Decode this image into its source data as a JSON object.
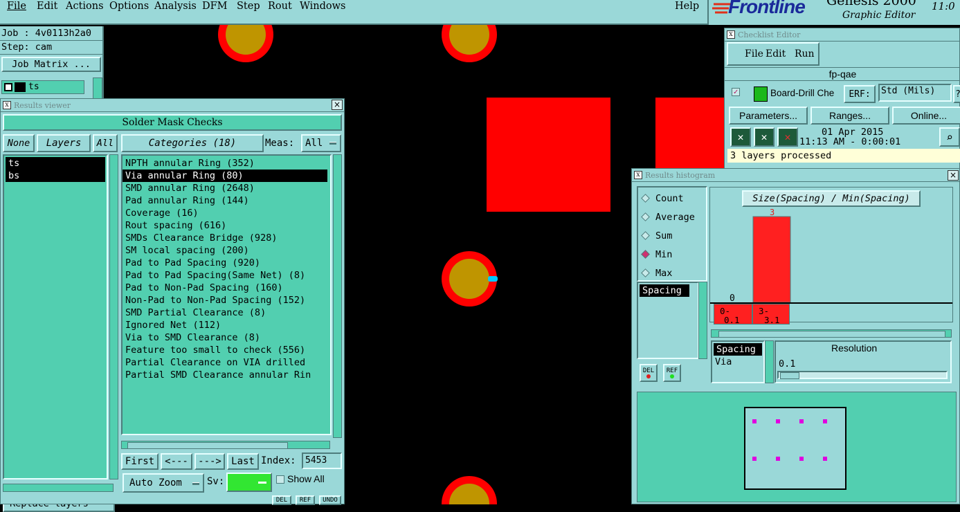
{
  "menubar": {
    "items": [
      "File",
      "Edit",
      "Actions",
      "Options",
      "Analysis",
      "DFM",
      "Step",
      "Rout",
      "Windows"
    ],
    "help": "Help"
  },
  "brand": {
    "logo": "Frontline",
    "product": "Genesis 2000",
    "subtitle": "Graphic Editor",
    "clock": "11:0"
  },
  "job_panel": {
    "job": "Job : 4v0113h2a0",
    "step": "Step: cam",
    "matrix_button": "Job Matrix ...",
    "layer": "ts",
    "replace_button": "Replace layers"
  },
  "results_viewer": {
    "title": "Results viewer",
    "heading": "Solder Mask Checks",
    "none_btn": "None",
    "layers_btn": "Layers",
    "all_btn": "All",
    "layers": [
      "ts",
      "bs"
    ],
    "categories_btn": "Categories (18)",
    "meas_label": "Meas:",
    "meas_value": "All",
    "categories": [
      "NPTH annular Ring (352)",
      "Via annular Ring (80)",
      "SMD annular Ring (2648)",
      "Pad annular Ring (144)",
      "Coverage (16)",
      "Rout spacing (616)",
      "SMDs Clearance Bridge (928)",
      "SM local spacing (200)",
      "Pad to Pad Spacing (920)",
      "Pad to Pad Spacing(Same Net) (8)",
      "Pad to Non-Pad Spacing (160)",
      "Non-Pad to Non-Pad Spacing (152)",
      "SMD Partial Clearance (8)",
      "Ignored Net (112)",
      "Via to SMD Clearance (8)",
      "Feature too small to check (556)",
      "Partial Clearance on VIA drilled",
      "Partial SMD Clearance annular Rin"
    ],
    "selected_index": 1,
    "first_btn": "First",
    "prev_btn": "<---",
    "next_btn": "--->",
    "last_btn": "Last",
    "index_label": "Index:",
    "index_value": "5453",
    "zoom_btn": "Auto Zoom",
    "sv_label": "Sv:",
    "show_all": "Show All",
    "del": "DEL",
    "ref": "REF",
    "undo": "UNDO"
  },
  "checklist": {
    "title": "Checklist Editor",
    "menu": [
      "File",
      "Edit",
      "Run"
    ],
    "name": "fp-qae",
    "row_label": "Board-Drill Che",
    "erf_label": "ERF:",
    "erf_value": "Std (Mils)",
    "parameters_btn": "Parameters...",
    "ranges_btn": "Ranges...",
    "online_btn": "Online...",
    "date": "01 Apr 2015",
    "time": "11:13 AM - 0:00:01",
    "status": "3 layers processed"
  },
  "histogram": {
    "title": "Results histogram",
    "modes": [
      "Count",
      "Average",
      "Sum",
      "Min",
      "Max"
    ],
    "selected_mode": "Min",
    "chart_title": "Size(Spacing) / Min(Spacing)",
    "bar_value_label": "3",
    "axis_zero": "0",
    "bin1_top": "0-",
    "bin1_bottom": "0.1",
    "bin2_top": "3-",
    "bin2_bottom": "3.1",
    "list_item": "Spacing",
    "del": "DEL",
    "ref": "REF",
    "attr_items": [
      "Spacing",
      "Via"
    ],
    "resolution_label": "Resolution",
    "resolution_value": "0.1",
    "chart_data": {
      "type": "bar",
      "categories": [
        "0-0.1",
        "3-3.1"
      ],
      "values": [
        0,
        3
      ],
      "title": "Size(Spacing) / Min(Spacing)"
    }
  },
  "colors": {
    "teal": "#9ad8d8",
    "green": "#52cfb0",
    "pad_red": "#ff0000",
    "pad_gold": "#bf9500",
    "marker": "#e000e0"
  }
}
